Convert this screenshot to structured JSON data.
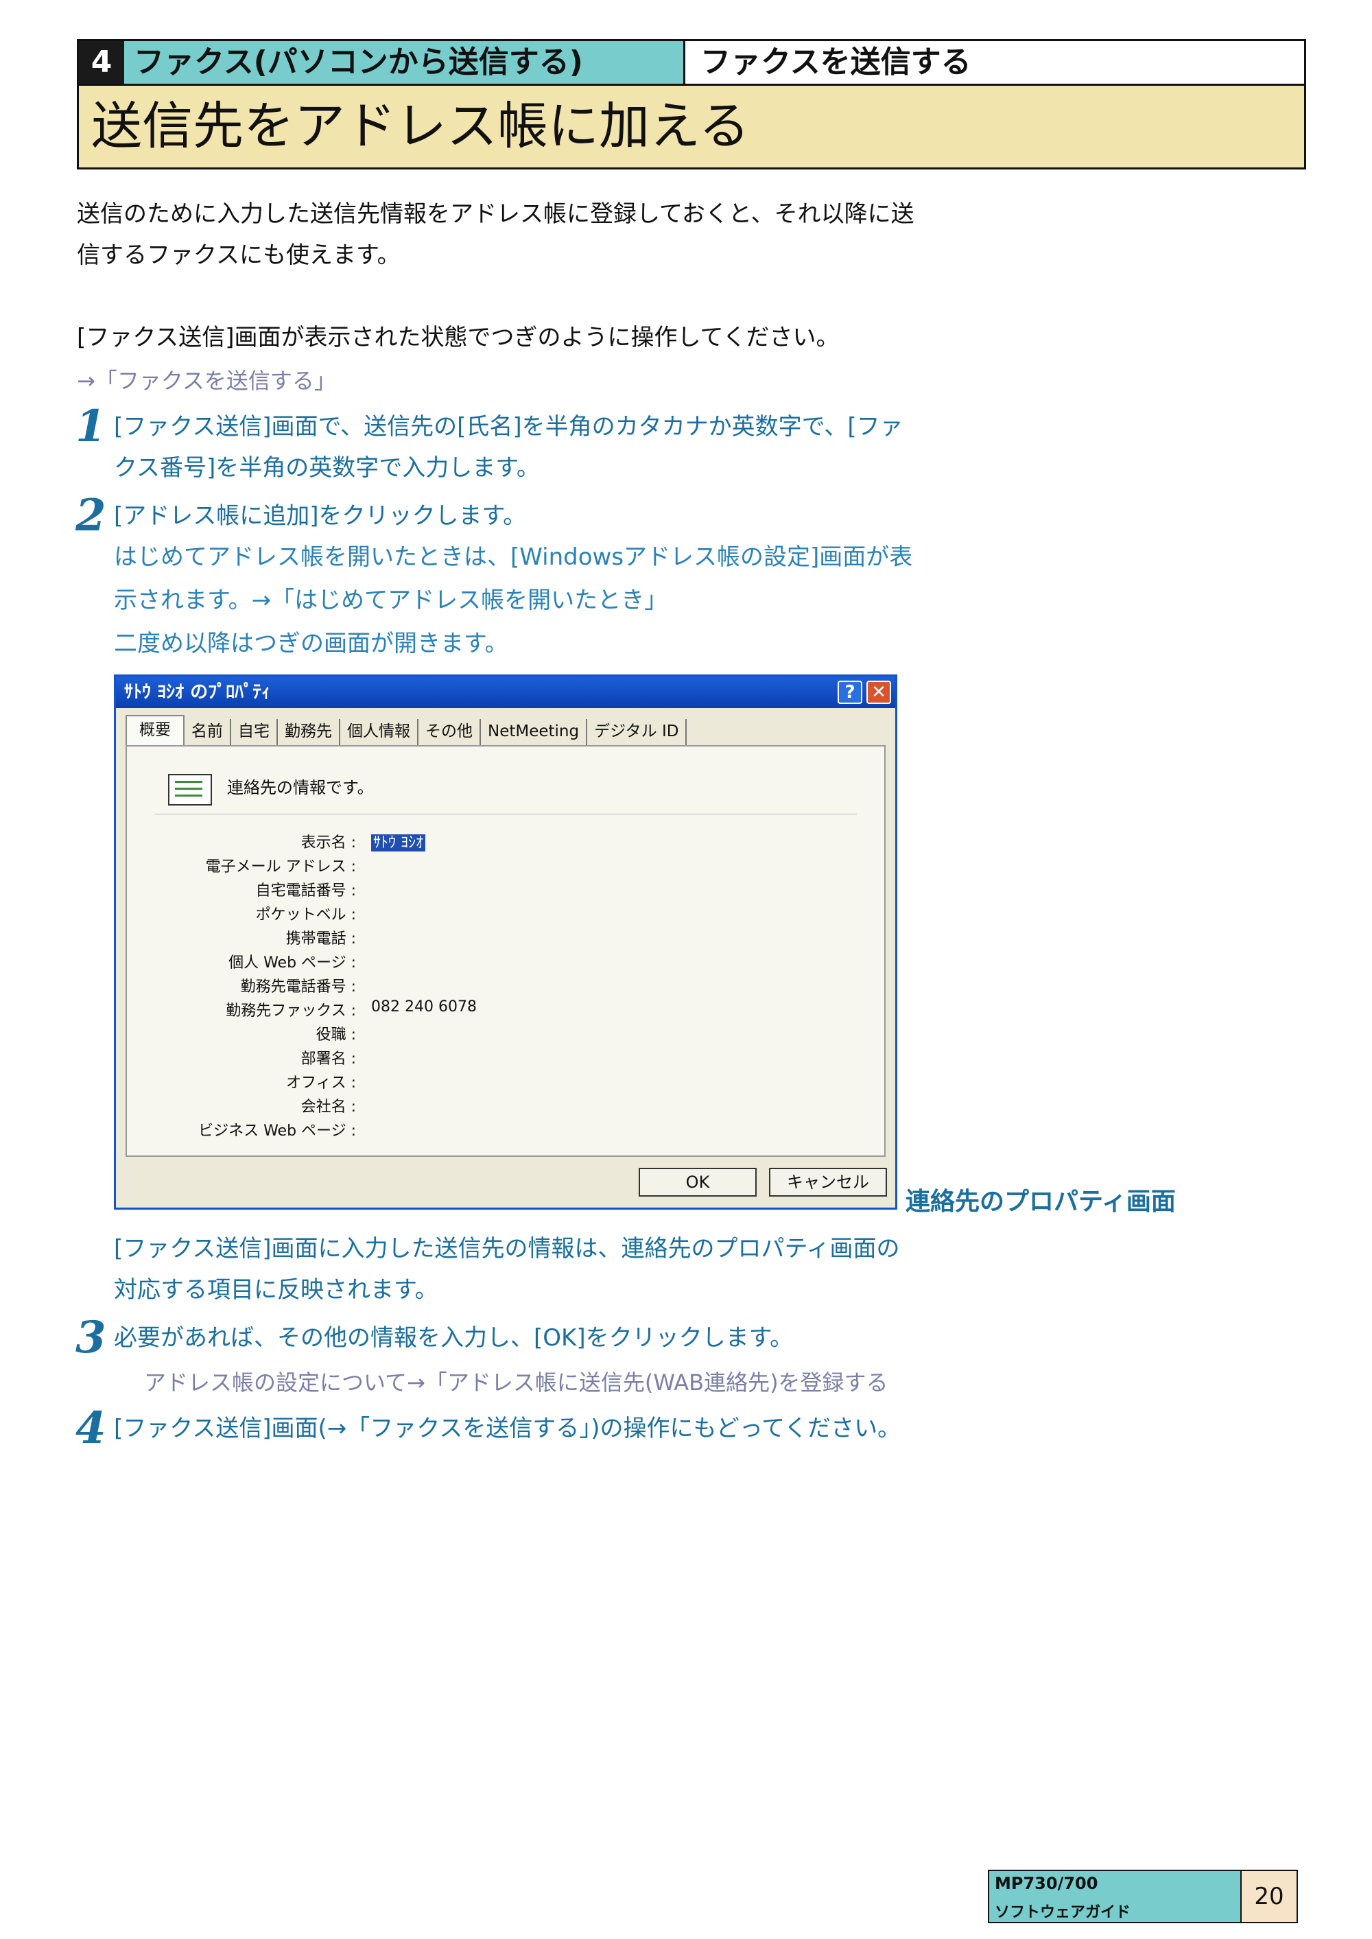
{
  "header": {
    "chapter_num": "4",
    "chapter_title": "ファクス(パソコンから送信する)",
    "section_title": "ファクスを送信する",
    "page_title": "送信先をアドレス帳に加える"
  },
  "intro": {
    "line1": "送信のために入力した送信先情報をアドレス帳に登録しておくと、それ以降に送",
    "line2": "信するファクスにも使えます。",
    "line3": "[ファクス送信]画面が表示された状態でつぎのように操作してください。",
    "link": "→「ファクスを送信する」"
  },
  "steps": [
    {
      "num": "1",
      "line1": "[ファクス送信]画面で、送信先の[氏名]を半角のカタカナか英数字で、[ファ",
      "line2": "クス番号]を半角の英数字で入力します。"
    },
    {
      "num": "2",
      "line1": "[アドレス帳に追加]をクリックします。",
      "sub1": "はじめてアドレス帳を開いたときは、[Windowsアドレス帳の設定]画面が表",
      "sub2": "示されます。→「はじめてアドレス帳を開いたとき」",
      "sub3": "二度め以降はつぎの画面が開きます。"
    },
    {
      "num": "3",
      "line1": "必要があれば、その他の情報を入力し、[OK]をクリックします。",
      "note": "アドレス帳の設定について→「アドレス帳に送信先(WAB連絡先)を登録する"
    },
    {
      "num": "4",
      "line1": "[ファクス送信]画面(→「ファクスを送信する」)の操作にもどってください。"
    }
  ],
  "after_dialog": {
    "line1": "[ファクス送信]画面に入力した送信先の情報は、連絡先のプロパティ画面の",
    "line2": "対応する項目に反映されます。"
  },
  "dialog": {
    "title": "ｻﾄｳ ﾖｼｵ のﾌﾟﾛﾊﾟﾃｨ",
    "help_btn": "?",
    "close_btn": "✕",
    "tabs": [
      "概要",
      "名前",
      "自宅",
      "勤務先",
      "個人情報",
      "その他",
      "NetMeeting",
      "デジタル ID"
    ],
    "info": "連絡先の情報です。",
    "fields": [
      {
        "label": "表示名 :",
        "value": "ｻﾄｳ ﾖｼｵ"
      },
      {
        "label": "電子メール アドレス :",
        "value": ""
      },
      {
        "label": "自宅電話番号 :",
        "value": ""
      },
      {
        "label": "ポケットベル :",
        "value": ""
      },
      {
        "label": "携帯電話 :",
        "value": ""
      },
      {
        "label": "個人 Web ページ :",
        "value": ""
      },
      {
        "label": "勤務先電話番号 :",
        "value": ""
      },
      {
        "label": "勤務先ファックス :",
        "value": "082 240 6078"
      },
      {
        "label": "役職 :",
        "value": ""
      },
      {
        "label": "部署名 :",
        "value": ""
      },
      {
        "label": "オフィス :",
        "value": ""
      },
      {
        "label": "会社名 :",
        "value": ""
      },
      {
        "label": "ビジネス Web ページ :",
        "value": ""
      }
    ],
    "ok": "OK",
    "cancel": "キャンセル",
    "caption": "連絡先のプロパティ画面"
  },
  "footer": {
    "model": "MP730/700",
    "guide": "ソフトウェアガイド",
    "page": "20"
  }
}
